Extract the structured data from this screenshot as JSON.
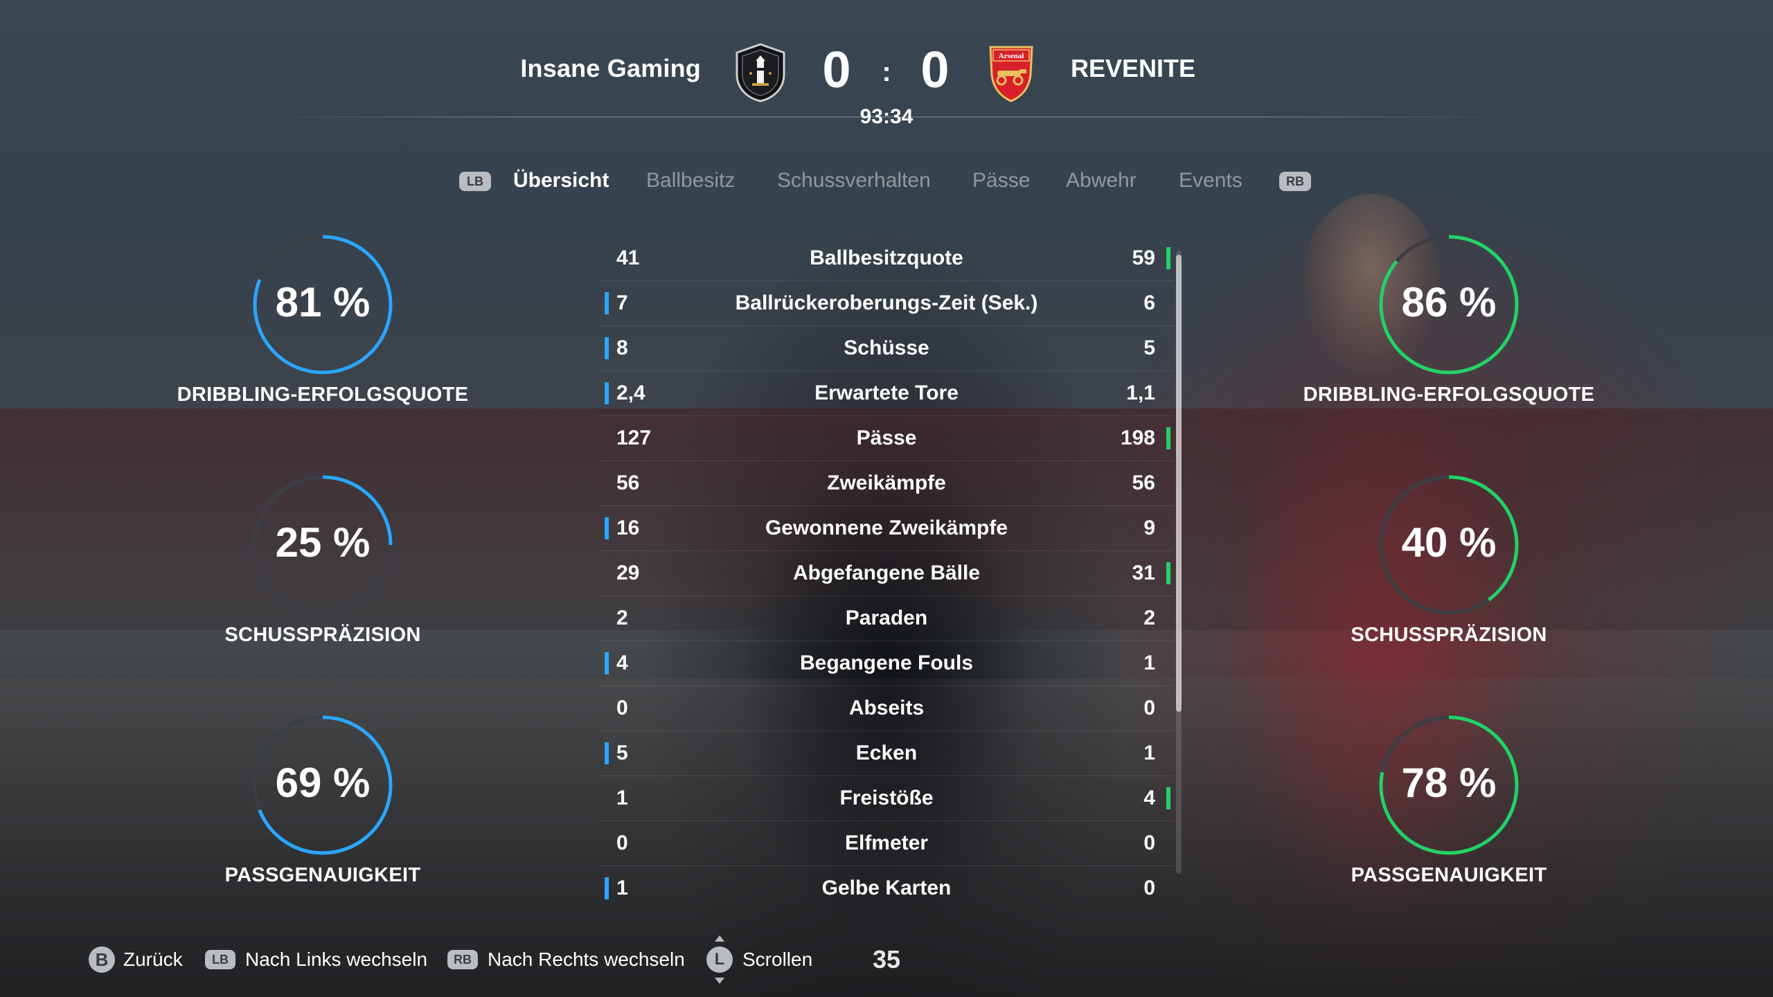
{
  "header": {
    "home_team": "Insane Gaming",
    "away_team": "REVENITE",
    "home_score": "0",
    "away_score": "0",
    "separator": ":",
    "clock": "93:34",
    "home_crest": "lighthouse-crest-icon",
    "away_crest": "cannon-shield-crest-icon",
    "away_crest_text": "Arsenal"
  },
  "tabs": {
    "lb": "LB",
    "rb": "RB",
    "items": [
      "Übersicht",
      "Ballbesitz",
      "Schussverhalten",
      "Pässe",
      "Abwehr",
      "Events"
    ],
    "active": 0
  },
  "colors": {
    "home": "#2aa6ff",
    "away": "#22d266",
    "ring_track": "#3b3f44",
    "button_bg": "#b9bcc0"
  },
  "home_rings": [
    {
      "value": "81 %",
      "percent": 81,
      "label": "DRIBBLING-ERFOLGSQUOTE"
    },
    {
      "value": "25 %",
      "percent": 25,
      "label": "SCHUSSPRÄZISION"
    },
    {
      "value": "69 %",
      "percent": 69,
      "label": "PASSGENAUIGKEIT"
    }
  ],
  "away_rings": [
    {
      "value": "86 %",
      "percent": 86,
      "label": "DRIBBLING-ERFOLGSQUOTE"
    },
    {
      "value": "40 %",
      "percent": 40,
      "label": "SCHUSSPRÄZISION"
    },
    {
      "value": "78 %",
      "percent": 78,
      "label": "PASSGENAUIGKEIT"
    }
  ],
  "stats": [
    {
      "label": "Ballbesitzquote",
      "home": "41",
      "away": "59",
      "leader": "away"
    },
    {
      "label": "Ballrückeroberungs-Zeit (Sek.)",
      "home": "7",
      "away": "6",
      "leader": "home"
    },
    {
      "label": "Schüsse",
      "home": "8",
      "away": "5",
      "leader": "home"
    },
    {
      "label": "Erwartete Tore",
      "home": "2,4",
      "away": "1,1",
      "leader": "home"
    },
    {
      "label": "Pässe",
      "home": "127",
      "away": "198",
      "leader": "away"
    },
    {
      "label": "Zweikämpfe",
      "home": "56",
      "away": "56",
      "leader": "none"
    },
    {
      "label": "Gewonnene Zweikämpfe",
      "home": "16",
      "away": "9",
      "leader": "home"
    },
    {
      "label": "Abgefangene Bälle",
      "home": "29",
      "away": "31",
      "leader": "away"
    },
    {
      "label": "Paraden",
      "home": "2",
      "away": "2",
      "leader": "none"
    },
    {
      "label": "Begangene Fouls",
      "home": "4",
      "away": "1",
      "leader": "home"
    },
    {
      "label": "Abseits",
      "home": "0",
      "away": "0",
      "leader": "none"
    },
    {
      "label": "Ecken",
      "home": "5",
      "away": "1",
      "leader": "home"
    },
    {
      "label": "Freistöße",
      "home": "1",
      "away": "4",
      "leader": "away"
    },
    {
      "label": "Elfmeter",
      "home": "0",
      "away": "0",
      "leader": "none"
    },
    {
      "label": "Gelbe Karten",
      "home": "1",
      "away": "0",
      "leader": "home"
    }
  ],
  "footer": {
    "back_button": "B",
    "back_label": "Zurück",
    "left_button": "LB",
    "left_label": "Nach Links wechseln",
    "right_button": "RB",
    "right_label": "Nach Rechts wechseln",
    "scroll_button": "L",
    "scroll_label": "Scrollen",
    "number": "35"
  }
}
